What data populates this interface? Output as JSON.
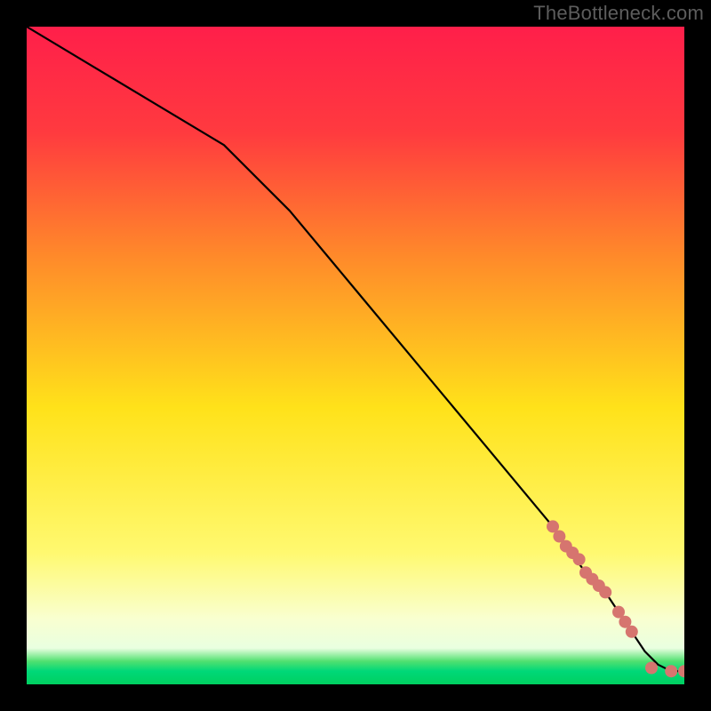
{
  "watermark": "TheBottleneck.com",
  "colors": {
    "gradient_top": "#ff1f4a",
    "gradient_mid1": "#ff8a2a",
    "gradient_mid2": "#ffe21a",
    "gradient_low": "#f9ffd0",
    "gradient_green_band_top": "#50e070",
    "gradient_green_band_bottom": "#00d060",
    "line": "#000000",
    "marker": "#d6756f",
    "frame": "#000000"
  },
  "chart_data": {
    "type": "line",
    "title": "",
    "xlabel": "",
    "ylabel": "",
    "xlim": [
      0,
      100
    ],
    "ylim": [
      0,
      100
    ],
    "grid": false,
    "legend": null,
    "series": [
      {
        "name": "curve",
        "x": [
          0,
          10,
          20,
          30,
          40,
          50,
          60,
          70,
          80,
          82,
          85,
          87,
          88,
          90,
          92,
          94,
          96,
          98,
          100
        ],
        "y": [
          100,
          94,
          88,
          82,
          72,
          60,
          48,
          36,
          24,
          21,
          17,
          15,
          14,
          11,
          8,
          5,
          3,
          2,
          2
        ]
      }
    ],
    "markers": {
      "name": "marker-points",
      "x": [
        80,
        81,
        82,
        83,
        84,
        85,
        86,
        87,
        88,
        90,
        91,
        92,
        95,
        98,
        100
      ],
      "y": [
        24,
        22.5,
        21,
        20,
        19,
        17,
        16,
        15,
        14,
        11,
        9.5,
        8,
        2.5,
        2,
        2
      ]
    }
  }
}
